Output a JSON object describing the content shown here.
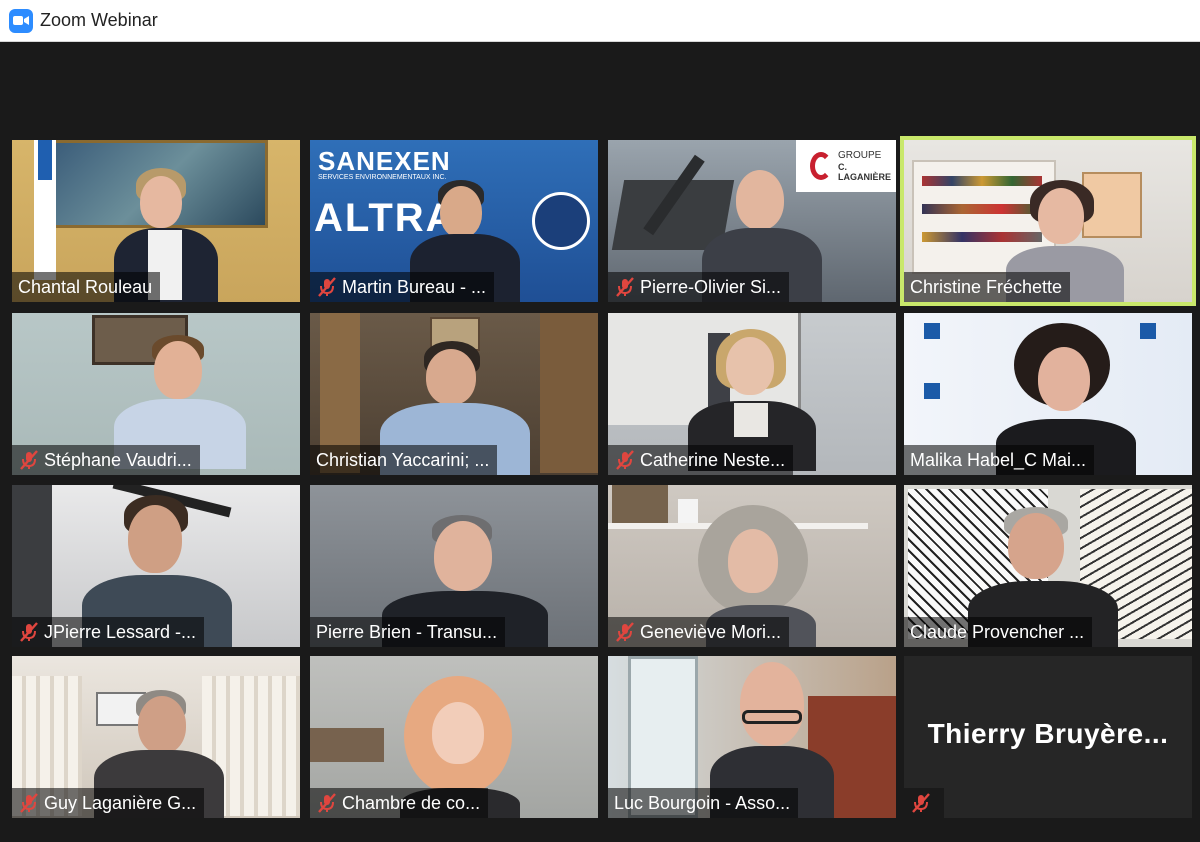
{
  "window": {
    "title": "Zoom Webinar",
    "icon": "zoom-camera-icon"
  },
  "colors": {
    "active_border": "#c9e86b",
    "mute_icon": "#e0463f",
    "zoom_blue": "#2d8cff"
  },
  "tiles": [
    {
      "name": "Chantal Rouleau",
      "muted": false,
      "active": false
    },
    {
      "name": "Martin Bureau - ...",
      "muted": true,
      "active": false,
      "logos": {
        "brand": "SANEXEN",
        "sub": "SERVICES ENVIRONNEMENTAUX INC.",
        "big": "ALTRA",
        "seal": "SOLAR IMPULSE · EFFICIENT SOLUTION"
      }
    },
    {
      "name": "Pierre-Olivier Si...",
      "muted": true,
      "active": false,
      "logos": {
        "group": "GROUPE",
        "brand": "C. LAGANIÈRE"
      }
    },
    {
      "name": "Christine Fréchette",
      "muted": false,
      "active": true
    },
    {
      "name": "Stéphane Vaudri...",
      "muted": true,
      "active": false
    },
    {
      "name": "Christian Yaccarini; ...",
      "muted": false,
      "active": false
    },
    {
      "name": "Catherine Neste...",
      "muted": true,
      "active": false
    },
    {
      "name": "Malika Habel_C Mai...",
      "muted": false,
      "active": false
    },
    {
      "name": "JPierre Lessard -...",
      "muted": true,
      "active": false
    },
    {
      "name": "Pierre Brien - Transu...",
      "muted": false,
      "active": false
    },
    {
      "name": "Geneviève Mori...",
      "muted": true,
      "active": false
    },
    {
      "name": "Claude Provencher ...",
      "muted": false,
      "active": false
    },
    {
      "name": "Guy Laganière G...",
      "muted": true,
      "active": false
    },
    {
      "name": "Chambre de co...",
      "muted": true,
      "active": false
    },
    {
      "name": "Luc Bourgoin - Asso...",
      "muted": false,
      "active": false
    },
    {
      "name": "",
      "display_name": "Thierry  Bruyère...",
      "muted": true,
      "active": false
    }
  ]
}
